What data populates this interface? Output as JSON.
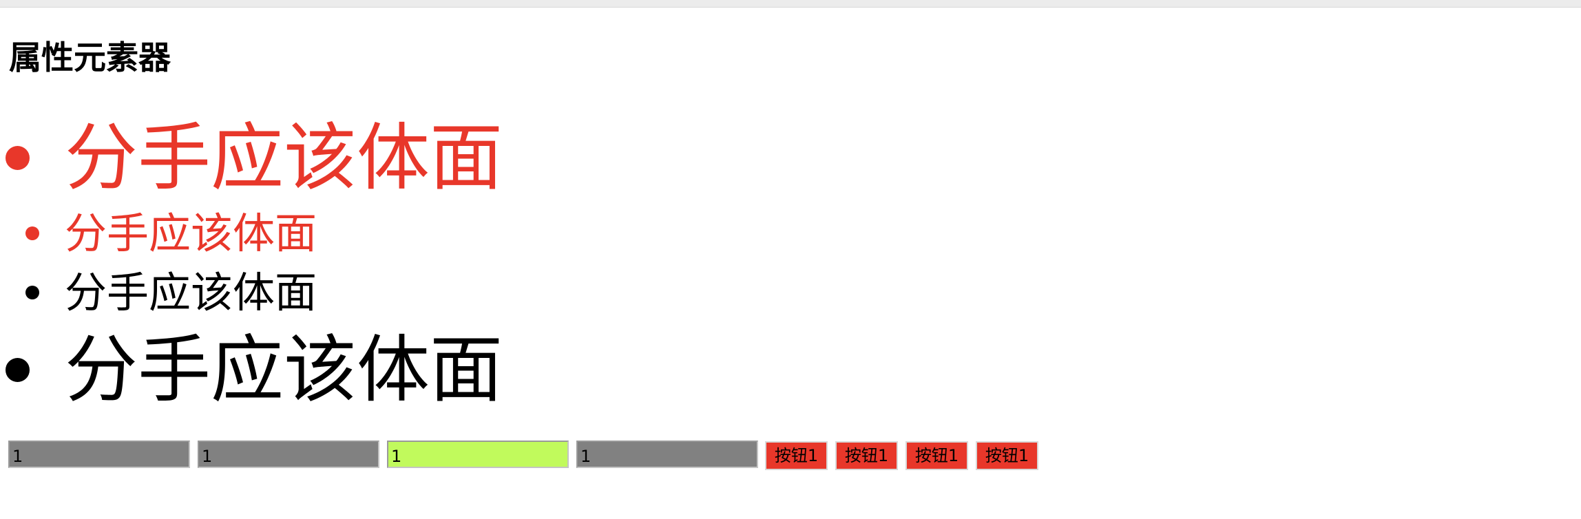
{
  "page": {
    "title": "属性元素器"
  },
  "list": {
    "items": [
      {
        "text": "分手应该体面",
        "color": "#e8372a"
      },
      {
        "text": "分手应该体面",
        "color": "#e8372a"
      },
      {
        "text": "分手应该体面",
        "color": "#000000"
      },
      {
        "text": "分手应该体面",
        "color": "#000000"
      }
    ]
  },
  "inputs": [
    {
      "value": "1",
      "background": "#818181"
    },
    {
      "value": "1",
      "background": "#818181"
    },
    {
      "value": "1",
      "background": "#c1fa5c"
    },
    {
      "value": "1",
      "background": "#818181"
    }
  ],
  "buttons": [
    {
      "label": "按钮1",
      "background": "#e8372a"
    },
    {
      "label": "按钮1",
      "background": "#e8372a"
    },
    {
      "label": "按钮1",
      "background": "#e8372a"
    },
    {
      "label": "按钮1",
      "background": "#e8372a"
    }
  ]
}
